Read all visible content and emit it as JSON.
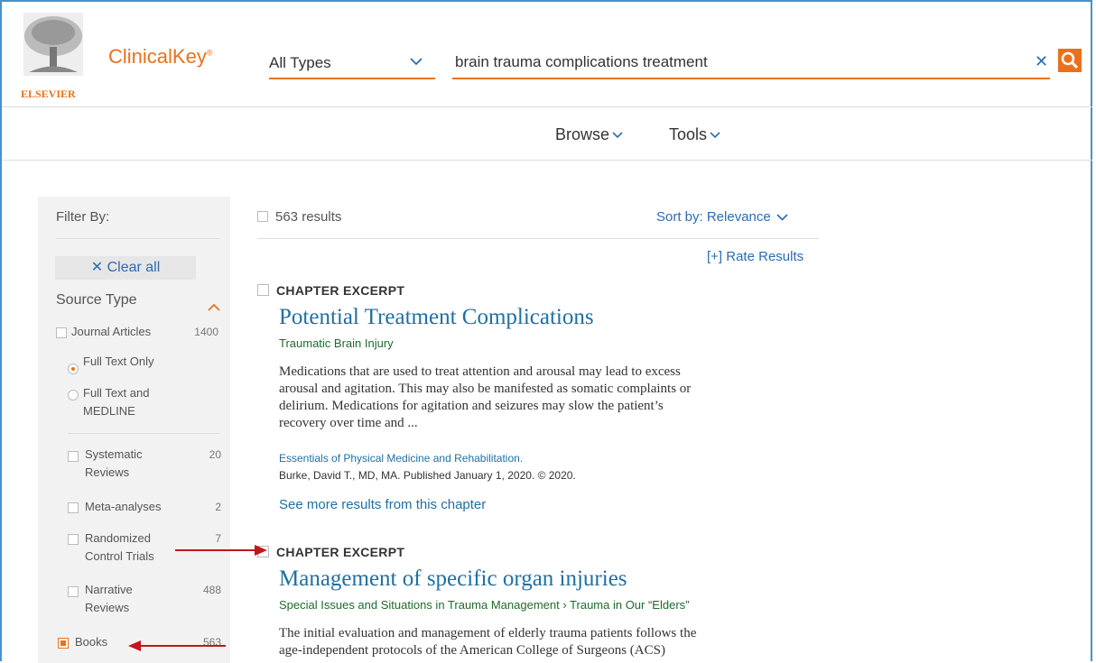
{
  "header": {
    "brand": "ClinicalKey",
    "brand_mark": "®",
    "publisher": "ELSEVIER",
    "type_select": "All Types",
    "search_value": "brain trauma complications treatment"
  },
  "nav": {
    "browse": "Browse",
    "tools": "Tools"
  },
  "sidebar": {
    "filter_by": "Filter By:",
    "clear_all": "Clear all",
    "source_type": "Source Type",
    "journal_articles": {
      "label": "Journal Articles",
      "count": "1400"
    },
    "full_text_only": "Full Text Only",
    "full_text_medline_1": "Full Text and",
    "full_text_medline_2": "MEDLINE",
    "systematic_1": "Systematic",
    "systematic_2": "Reviews",
    "systematic_count": "20",
    "meta": {
      "label": "Meta-analyses",
      "count": "2"
    },
    "rct_1": "Randomized",
    "rct_2": "Control Trials",
    "rct_count": "7",
    "narrative_1": "Narrative",
    "narrative_2": "Reviews",
    "narrative_count": "488",
    "books": {
      "label": "Books",
      "count": "563"
    }
  },
  "results": {
    "count": "563 results",
    "sort": "Sort by: Relevance",
    "rate": "[+] Rate Results",
    "items": [
      {
        "kind": "CHAPTER EXCERPT",
        "title": "Potential Treatment Complications",
        "subtitle": "Traumatic Brain Injury",
        "body_1": "Medications that are used to treat attention and arousal may lead to excess",
        "body_2": "arousal and agitation. This may also be manifested as somatic complaints or",
        "body_3": "delirium. Medications for agitation and seizures may slow the patient’s",
        "body_4": "recovery over time and ...",
        "source": "Essentials of Physical Medicine and Rehabilitation.",
        "author": "Burke, David T., MD, MA. Published January 1, 2020. © 2020.",
        "more": "See more results from this chapter"
      },
      {
        "kind": "CHAPTER EXCERPT",
        "title": "Management of specific organ injuries",
        "subtitle": "Special Issues and Situations in Trauma Management › Trauma in Our “Elders”",
        "body_1": "The initial evaluation and management of elderly trauma patients follows the",
        "body_2": "age-independent protocols of the American College of Surgeons (ACS)"
      }
    ]
  },
  "colors": {
    "accent": "#e9711c",
    "link": "#1f6fa3",
    "annotation_arrow": "#c0161c"
  }
}
